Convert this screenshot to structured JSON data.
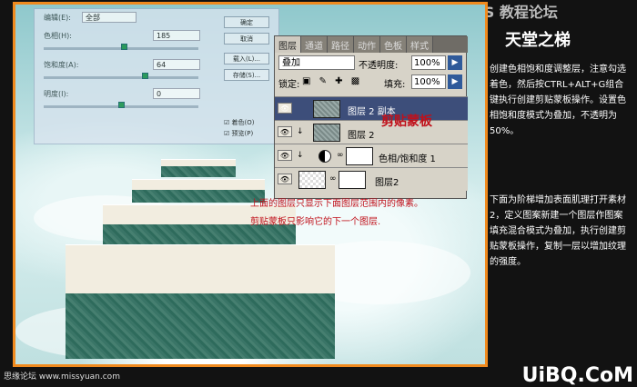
{
  "watermark_top": "PS 教程论坛",
  "dialog": {
    "edit_label": "编辑(E):",
    "edit_value": "全部",
    "hue_label": "色相(H):",
    "hue_value": "185",
    "sat_label": "饱和度(A):",
    "sat_value": "64",
    "light_label": "明度(I):",
    "light_value": "0",
    "ok": "确定",
    "cancel": "取消",
    "load": "载入(L)...",
    "save": "存储(S)...",
    "colorize": "着色(O)",
    "preview": "预览(P)"
  },
  "layers_panel": {
    "tabs": [
      "图层",
      "通道",
      "路径",
      "动作",
      "色板",
      "样式"
    ],
    "blend_mode": "叠加",
    "opacity_label": "不透明度:",
    "opacity_value": "100%",
    "lock_label": "锁定:",
    "fill_label": "填充:",
    "fill_value": "100%",
    "rows": [
      {
        "name": "图层 2 副本"
      },
      {
        "name": "图层 2"
      },
      {
        "name": "色相/饱和度 1"
      },
      {
        "name": "图层2"
      }
    ]
  },
  "notes": {
    "clipping_mask": "剪贴蒙板",
    "note1": "上面的图层只显示下面图层范围内的像素。",
    "note2": "剪贴蒙板只影响它的下一个图层."
  },
  "right_title": "天堂之梯",
  "right_para1": "创建色相饱和度调整层，注意勾选着色，然后按CTRL+ALT+G组合键执行创建剪贴蒙板操作。设置色相饱和度模式为叠加，不透明为50%。",
  "right_para2": "下面为阶梯增加表面肌理打开素材2，定义图案新建一个图层作图案填充混合模式为叠加，执行创建剪贴蒙板操作，复制一层以增加纹理的强度。",
  "footer_left": "思缘论坛 www.missyuan.com",
  "footer_right": "UiBQ.CoM",
  "colors": {
    "accent": "#f08a1e",
    "note": "#c0101a"
  }
}
